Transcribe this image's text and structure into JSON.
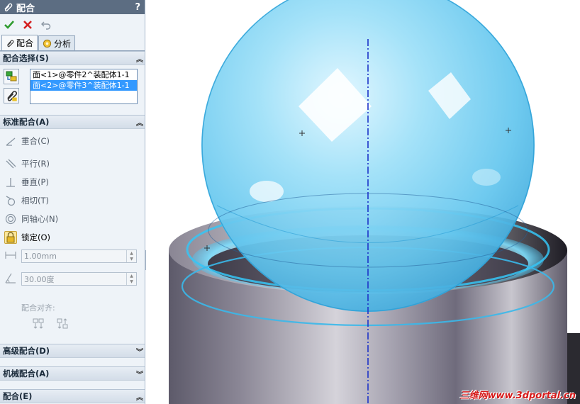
{
  "panel": {
    "title": "配合",
    "help": "?",
    "tabs": [
      {
        "label": "配合",
        "active": true
      },
      {
        "label": "分析",
        "active": false
      }
    ],
    "sections": {
      "selection": {
        "title": "配合选择(S)",
        "items": [
          {
            "text": "面<1>@零件2^装配体1-1",
            "selected": false
          },
          {
            "text": "面<2>@零件3^装配体1-1",
            "selected": true
          }
        ]
      },
      "standard": {
        "title": "标准配合(A)",
        "mates": {
          "coincident": "重合(C)",
          "parallel": "平行(R)",
          "perpendicular": "垂直(P)",
          "tangent": "相切(T)",
          "concentric": "同轴心(N)",
          "lock": "锁定(O)"
        },
        "distance_value": "1.00mm",
        "angle_value": "30.00度",
        "align_label": "配合对齐:"
      },
      "advanced": {
        "title": "高级配合(D)"
      },
      "mechanical": {
        "title": "机械配合(A)"
      },
      "mates": {
        "title": "配合(E)"
      }
    }
  },
  "colors": {
    "title_bar": "#5c6d82",
    "selected_row": "#3399ff",
    "sphere": "#8fd8f5",
    "watermark": "#d61a1a"
  },
  "watermark": "三维网www.3dportal.cn"
}
